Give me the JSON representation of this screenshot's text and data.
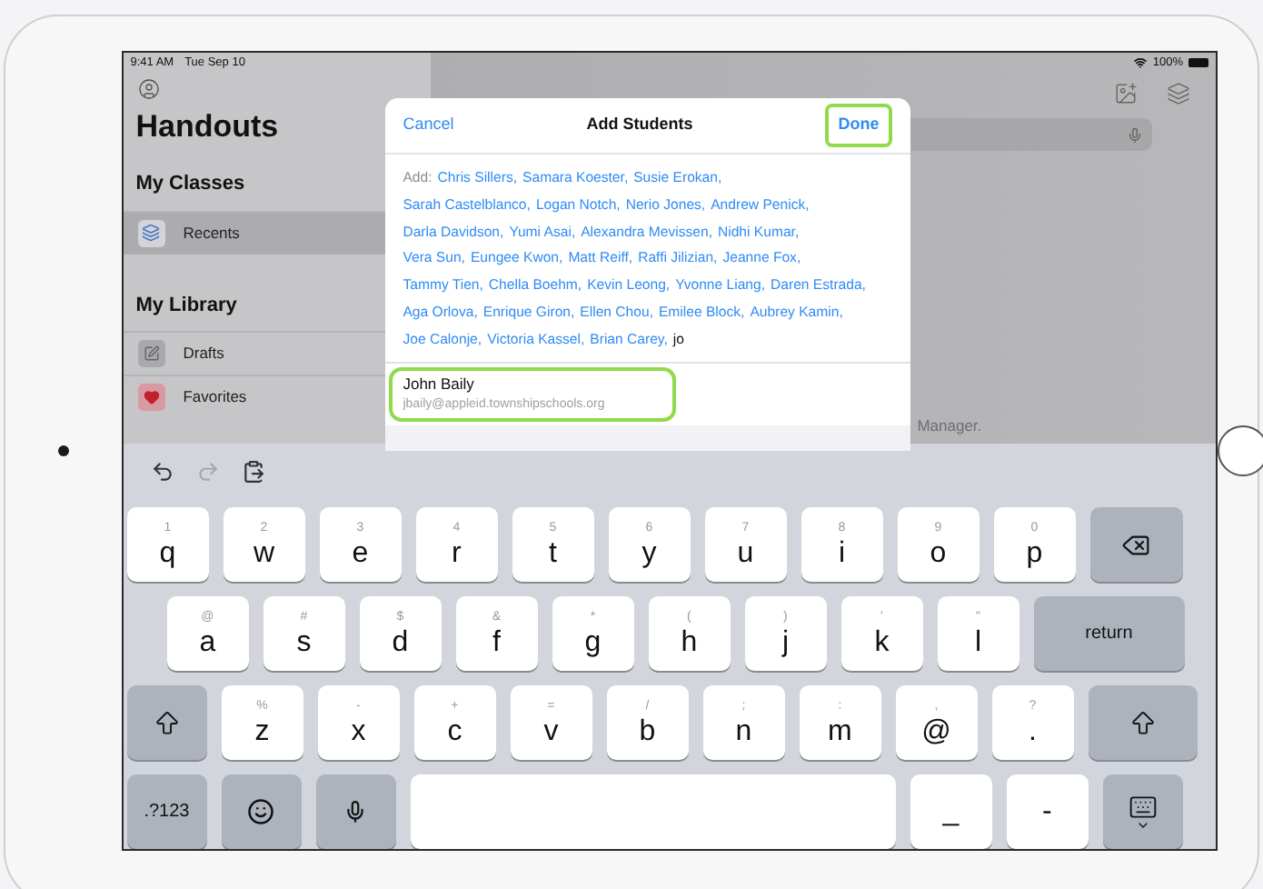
{
  "status_bar": {
    "time": "9:41 AM",
    "date": "Tue Sep 10",
    "battery": "100%"
  },
  "sidebar": {
    "title": "Handouts",
    "sections": [
      {
        "heading": "My Classes",
        "items": [
          {
            "label": "Recents",
            "kind": "recents",
            "selected": true
          }
        ]
      },
      {
        "heading": "My Library",
        "items": [
          {
            "label": "Drafts",
            "kind": "drafts",
            "selected": false
          },
          {
            "label": "Favorites",
            "kind": "favorites",
            "selected": false
          }
        ]
      }
    ]
  },
  "main": {
    "footer_text": "Manager."
  },
  "sheet": {
    "title": "Add Students",
    "cancel": "Cancel",
    "done": {
      "label": "Done",
      "highlighted": true
    },
    "prefix": "Add:",
    "recipient_lines": [
      [
        "Chris Sillers,",
        "Samara Koester,",
        "Susie Erokan,"
      ],
      [
        "Sarah Castelblanco,",
        "Logan Notch,",
        "Nerio Jones,",
        "Andrew Penick,"
      ],
      [
        "Darla Davidson,",
        "Yumi Asai,",
        "Alexandra Mevissen,",
        "Nidhi Kumar,"
      ],
      [
        "Vera Sun,",
        "Eungee Kwon,",
        "Matt Reiff,",
        "Raffi Jilizian,",
        "Jeanne Fox,"
      ],
      [
        "Tammy Tien,",
        "Chella Boehm,",
        "Kevin Leong,",
        "Yvonne Liang,",
        "Daren Estrada,"
      ],
      [
        "Aga Orlova,",
        "Enrique Giron,",
        "Ellen Chou,",
        "Emilee Block,",
        "Aubrey Kamin,"
      ],
      [
        "Joe Calonje,",
        "Victoria Kassel,",
        "Brian Carey,"
      ]
    ],
    "typed": "jo",
    "suggestion": {
      "name": "John Baily",
      "email": "jbaily@appleid.townshipschools.org",
      "highlighted": true
    }
  },
  "keyboard": {
    "toolbar": [
      {
        "kind": "undo",
        "disabled": false
      },
      {
        "kind": "redo",
        "disabled": true
      },
      {
        "kind": "paste",
        "disabled": false
      }
    ],
    "rows": [
      [
        {
          "kind": "letter",
          "char": "q",
          "hint": "1"
        },
        {
          "kind": "letter",
          "char": "w",
          "hint": "2"
        },
        {
          "kind": "letter",
          "char": "e",
          "hint": "3"
        },
        {
          "kind": "letter",
          "char": "r",
          "hint": "4"
        },
        {
          "kind": "letter",
          "char": "t",
          "hint": "5"
        },
        {
          "kind": "letter",
          "char": "y",
          "hint": "6"
        },
        {
          "kind": "letter",
          "char": "u",
          "hint": "7"
        },
        {
          "kind": "letter",
          "char": "i",
          "hint": "8"
        },
        {
          "kind": "letter",
          "char": "o",
          "hint": "9"
        },
        {
          "kind": "letter",
          "char": "p",
          "hint": "0"
        },
        {
          "kind": "delete"
        }
      ],
      [
        {
          "kind": "letter",
          "char": "a",
          "hint": "@"
        },
        {
          "kind": "letter",
          "char": "s",
          "hint": "#"
        },
        {
          "kind": "letter",
          "char": "d",
          "hint": "$"
        },
        {
          "kind": "letter",
          "char": "f",
          "hint": "&"
        },
        {
          "kind": "letter",
          "char": "g",
          "hint": "*"
        },
        {
          "kind": "letter",
          "char": "h",
          "hint": "("
        },
        {
          "kind": "letter",
          "char": "j",
          "hint": ")"
        },
        {
          "kind": "letter",
          "char": "k",
          "hint": "'"
        },
        {
          "kind": "letter",
          "char": "l",
          "hint": "\""
        },
        {
          "kind": "return",
          "label": "return"
        }
      ],
      [
        {
          "kind": "shift"
        },
        {
          "kind": "letter",
          "char": "z",
          "hint": "%"
        },
        {
          "kind": "letter",
          "char": "x",
          "hint": "-"
        },
        {
          "kind": "letter",
          "char": "c",
          "hint": "+"
        },
        {
          "kind": "letter",
          "char": "v",
          "hint": "="
        },
        {
          "kind": "letter",
          "char": "b",
          "hint": "/"
        },
        {
          "kind": "letter",
          "char": "n",
          "hint": ";"
        },
        {
          "kind": "letter",
          "char": "m",
          "hint": ":"
        },
        {
          "kind": "letter",
          "char": "@",
          "hint": ","
        },
        {
          "kind": "letter",
          "char": ".",
          "hint": "?"
        },
        {
          "kind": "shift"
        }
      ],
      [
        {
          "kind": "numbers",
          "label": ".?123"
        },
        {
          "kind": "emoji"
        },
        {
          "kind": "mic"
        },
        {
          "kind": "space"
        },
        {
          "kind": "letter",
          "char": "_"
        },
        {
          "kind": "letter",
          "char": "-"
        },
        {
          "kind": "dismiss"
        }
      ]
    ]
  }
}
